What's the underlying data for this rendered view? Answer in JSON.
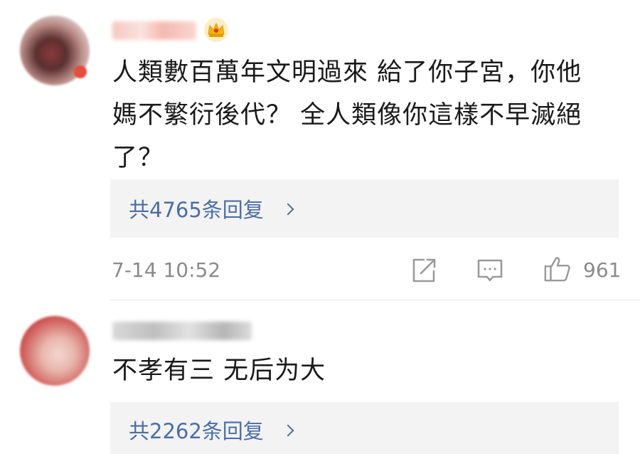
{
  "comments": [
    {
      "username": "",
      "badge_icon": "crown-icon",
      "text_lines": [
        "人類數百萬年文明過來 給了你子宮，你他",
        "媽不繁衍後代？ 全人類像你這樣不早滅絕",
        "了？"
      ],
      "replies_label": "共4765条回复",
      "timestamp": "7-14 10:52",
      "likes": "961"
    },
    {
      "username": "",
      "text_lines": [
        "不孝有三 无后为大"
      ],
      "replies_label": "共2262条回复"
    }
  ],
  "icons": {
    "share": "share-icon",
    "comment": "comment-icon",
    "like": "thumbs-up-icon"
  },
  "colors": {
    "reply_link": "#4a6ea3",
    "meta_text": "#8a8a8a",
    "reply_bg": "#f3f3f3",
    "crown_gold": "#f4b400"
  }
}
